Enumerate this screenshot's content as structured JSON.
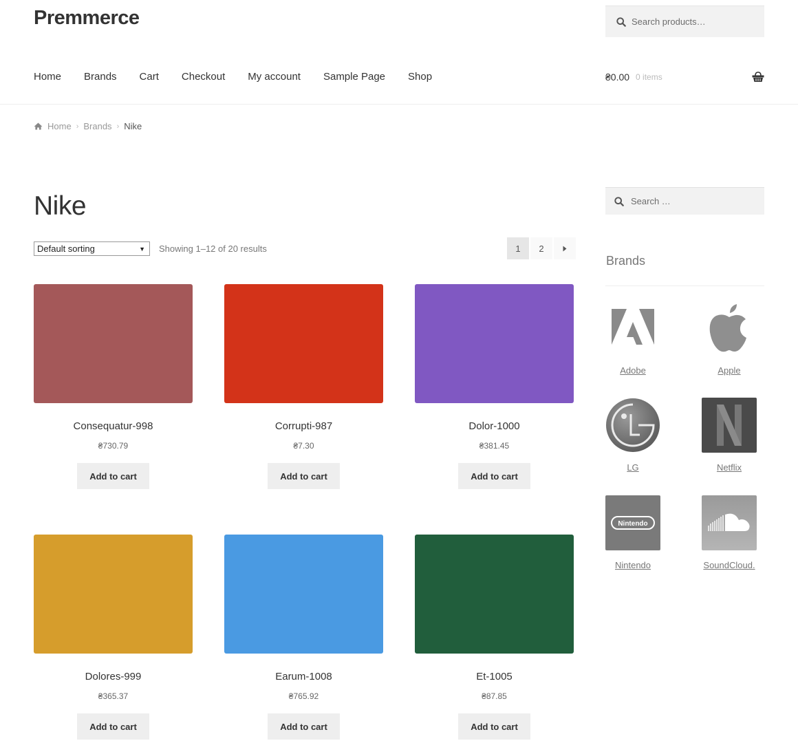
{
  "site": {
    "title": "Premmerce"
  },
  "header_search": {
    "placeholder": "Search products…",
    "icon": "search-icon"
  },
  "nav": {
    "items": [
      {
        "label": "Home"
      },
      {
        "label": "Brands"
      },
      {
        "label": "Cart"
      },
      {
        "label": "Checkout"
      },
      {
        "label": "My account"
      },
      {
        "label": "Sample Page"
      },
      {
        "label": "Shop"
      }
    ]
  },
  "cart": {
    "amount": "₴0.00",
    "count": "0 items",
    "icon": "basket-icon"
  },
  "breadcrumb": {
    "icon": "home-icon",
    "items": [
      {
        "label": "Home"
      },
      {
        "label": "Brands"
      },
      {
        "label": "Nike"
      }
    ]
  },
  "page": {
    "title": "Nike"
  },
  "toolbar": {
    "sort_selected": "Default sorting",
    "result_count": "Showing 1–12 of 20 results",
    "pagination": {
      "pages": [
        "1",
        "2"
      ],
      "current": "1",
      "next_icon": "▸"
    }
  },
  "products": [
    {
      "name": "Consequatur-998",
      "price": "₴730.79",
      "color": "#a45859",
      "button": "Add to cart"
    },
    {
      "name": "Corrupti-987",
      "price": "₴7.30",
      "color": "#d33319",
      "button": "Add to cart"
    },
    {
      "name": "Dolor-1000",
      "price": "₴381.45",
      "color": "#8058c2",
      "button": "Add to cart"
    },
    {
      "name": "Dolores-999",
      "price": "₴365.37",
      "color": "#d69d2c",
      "button": "Add to cart"
    },
    {
      "name": "Earum-1008",
      "price": "₴765.92",
      "color": "#4a9ae2",
      "button": "Add to cart"
    },
    {
      "name": "Et-1005",
      "price": "₴87.85",
      "color": "#215e3c",
      "button": "Add to cart"
    }
  ],
  "sidebar": {
    "search_placeholder": "Search …",
    "brands_title": "Brands",
    "brands": [
      {
        "name": "Adobe",
        "logo": "adobe-logo"
      },
      {
        "name": "Apple",
        "logo": "apple-logo"
      },
      {
        "name": "LG",
        "logo": "lg-logo"
      },
      {
        "name": "Netflix",
        "logo": "netflix-logo"
      },
      {
        "name": "Nintendo",
        "logo": "nintendo-logo"
      },
      {
        "name": "SoundCloud.",
        "logo": "soundcloud-logo"
      }
    ]
  }
}
